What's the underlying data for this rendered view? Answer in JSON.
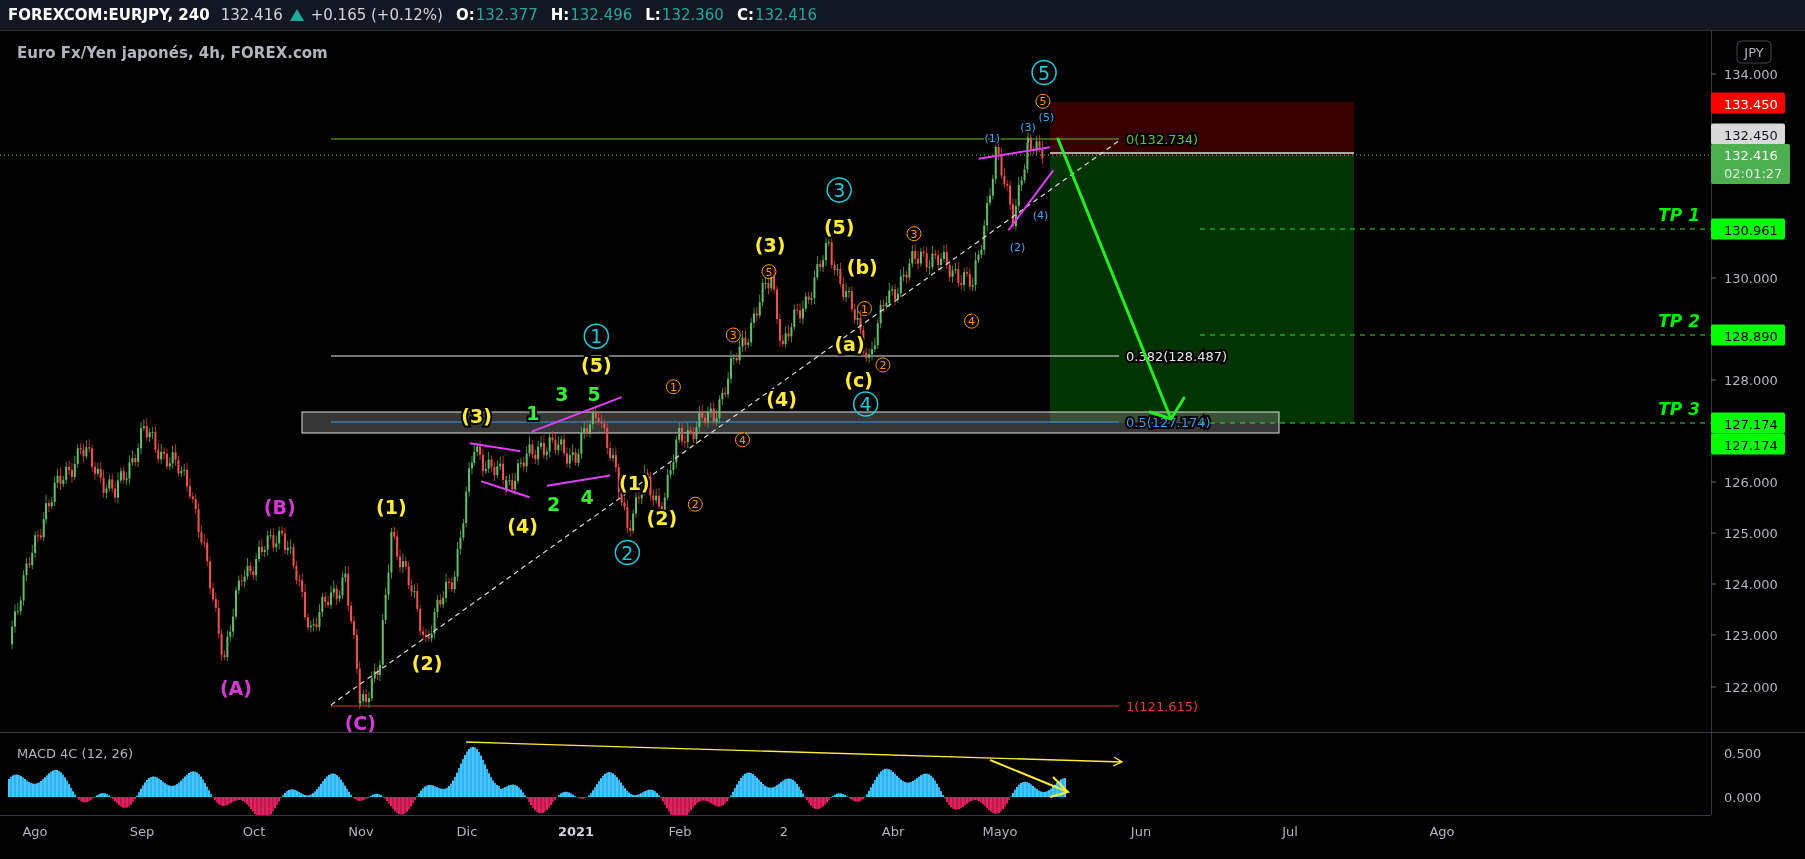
{
  "header": {
    "symbol": "FOREXCOM:EURJPY, 240",
    "price": "132.416",
    "change": "+0.165 (+0.12%)",
    "ohlc": [
      {
        "label": "O:",
        "value": "132.377"
      },
      {
        "label": "H:",
        "value": "132.496"
      },
      {
        "label": "L:",
        "value": "132.360"
      },
      {
        "label": "C:",
        "value": "132.416"
      }
    ]
  },
  "chart": {
    "title": "Euro Fx/Yen japonés, 4h, FOREX.com",
    "currency": "JPY",
    "price_ticks": [
      "134.000",
      "130.000",
      "128.000",
      "126.000",
      "125.000",
      "124.000",
      "123.000",
      "122.000"
    ],
    "price_tags": [
      {
        "text": "133.450",
        "kind": "stop"
      },
      {
        "text": "132.450",
        "kind": "line"
      },
      {
        "text": "132.416",
        "kind": "last",
        "countdown": "02:01:27"
      },
      {
        "text": "130.961",
        "kind": "target"
      },
      {
        "text": "128.890",
        "kind": "target"
      },
      {
        "text": "127.174",
        "kind": "target"
      },
      {
        "text": "127.174",
        "kind": "target"
      }
    ],
    "targets": [
      "TP 1",
      "TP 2",
      "TP 3"
    ],
    "fib_levels": [
      {
        "text": "0(132.734)",
        "color": "#6cc02a"
      },
      {
        "text": "0.382(128.487)",
        "color": "#e8e8e8"
      },
      {
        "text": "0.5(127.174)",
        "color": "#3d9be9"
      },
      {
        "text": "1(121.615)",
        "color": "#e53935"
      }
    ],
    "wave_labels": [
      {
        "text": "(B)",
        "color": "#d63ad6",
        "kind": "plain"
      },
      {
        "text": "(A)",
        "color": "#d63ad6",
        "kind": "plain"
      },
      {
        "text": "(C)",
        "color": "#d63ad6",
        "kind": "plain"
      },
      {
        "text": "(1)",
        "color": "#ffeb3b",
        "kind": "plain"
      },
      {
        "text": "(2)",
        "color": "#ffeb3b",
        "kind": "plain"
      },
      {
        "text": "(3)",
        "color": "#ffeb3b",
        "kind": "plain"
      },
      {
        "text": "(4)",
        "color": "#ffeb3b",
        "kind": "plain"
      },
      {
        "text": "(5)",
        "color": "#ffeb3b",
        "kind": "plain"
      },
      {
        "text": "(1)",
        "color": "#ffeb3b",
        "kind": "plain"
      },
      {
        "text": "(2)",
        "color": "#ffeb3b",
        "kind": "plain"
      },
      {
        "text": "(3)",
        "color": "#ffeb3b",
        "kind": "plain"
      },
      {
        "text": "(4)",
        "color": "#ffeb3b",
        "kind": "plain"
      },
      {
        "text": "(5)",
        "color": "#ffeb3b",
        "kind": "plain"
      },
      {
        "text": "(b)",
        "color": "#ffeb3b",
        "kind": "plain"
      },
      {
        "text": "(a)",
        "color": "#ffeb3b",
        "kind": "plain"
      },
      {
        "text": "(c)",
        "color": "#ffeb3b",
        "kind": "plain"
      },
      {
        "text": "1",
        "color": "#33ee33",
        "kind": "plain"
      },
      {
        "text": "3",
        "color": "#33ee33",
        "kind": "plain"
      },
      {
        "text": "5",
        "color": "#33ee33",
        "kind": "plain"
      },
      {
        "text": "2",
        "color": "#33ee33",
        "kind": "plain"
      },
      {
        "text": "4",
        "color": "#33ee33",
        "kind": "plain"
      },
      {
        "text": "1",
        "color": "#26c6da",
        "kind": "circled"
      },
      {
        "text": "2",
        "color": "#26c6da",
        "kind": "circled"
      },
      {
        "text": "3",
        "color": "#26c6da",
        "kind": "circled"
      },
      {
        "text": "4",
        "color": "#26c6da",
        "kind": "circled"
      },
      {
        "text": "5",
        "color": "#26c6da",
        "kind": "circled"
      },
      {
        "text": "1",
        "color": "#ff9800",
        "kind": "small_circled"
      },
      {
        "text": "2",
        "color": "#ff9800",
        "kind": "small_circled"
      },
      {
        "text": "3",
        "color": "#ff9800",
        "kind": "small_circled"
      },
      {
        "text": "4",
        "color": "#ff9800",
        "kind": "small_circled"
      },
      {
        "text": "5",
        "color": "#ff9800",
        "kind": "small_circled"
      },
      {
        "text": "1",
        "color": "#ff9800",
        "kind": "small_circled"
      },
      {
        "text": "2",
        "color": "#ff9800",
        "kind": "small_circled"
      },
      {
        "text": "3",
        "color": "#ff9800",
        "kind": "small_circled"
      },
      {
        "text": "4",
        "color": "#ff9800",
        "kind": "small_circled"
      },
      {
        "text": "5",
        "color": "#ff9800",
        "kind": "small_circled"
      },
      {
        "text": "(1)",
        "color": "#42a5f5",
        "kind": "small"
      },
      {
        "text": "(2)",
        "color": "#42a5f5",
        "kind": "small"
      },
      {
        "text": "(3)",
        "color": "#42a5f5",
        "kind": "small"
      },
      {
        "text": "(5)",
        "color": "#42a5f5",
        "kind": "small"
      },
      {
        "text": "(4)",
        "color": "#42a5f5",
        "kind": "small"
      }
    ]
  },
  "macd": {
    "title": "MACD 4C (12, 26)",
    "ticks": [
      "0.500",
      "0.000"
    ]
  },
  "time_axis": [
    {
      "text": "Ago",
      "kind": "month"
    },
    {
      "text": "Sep",
      "kind": "month"
    },
    {
      "text": "Oct",
      "kind": "month"
    },
    {
      "text": "Nov",
      "kind": "month"
    },
    {
      "text": "Dic",
      "kind": "month"
    },
    {
      "text": "2021",
      "kind": "year"
    },
    {
      "text": "Feb",
      "kind": "month"
    },
    {
      "text": "2",
      "kind": "month"
    },
    {
      "text": "Abr",
      "kind": "month"
    },
    {
      "text": "Mayo",
      "kind": "month"
    },
    {
      "text": "Jun",
      "kind": "month"
    },
    {
      "text": "Jul",
      "kind": "month"
    },
    {
      "text": "Ago",
      "kind": "month"
    }
  ]
}
